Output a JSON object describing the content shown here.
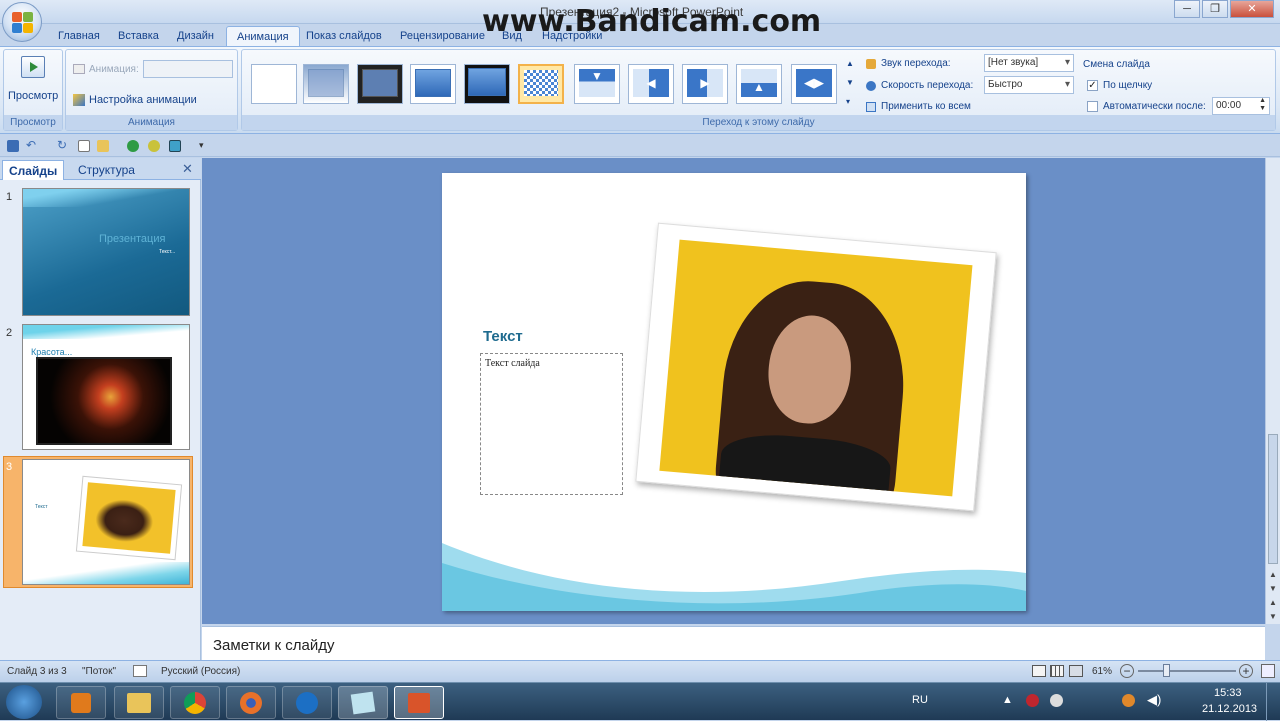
{
  "window": {
    "title": "Презентация2 - Microsoft PowerPoint",
    "watermark": "www.Bandicam.com",
    "minimize": "─",
    "maximize": "❐",
    "close": "✕"
  },
  "ribbon_tabs": [
    "Главная",
    "Вставка",
    "Дизайн",
    "Анимация",
    "Показ слайдов",
    "Рецензирование",
    "Вид",
    "Надстройки"
  ],
  "active_tab": "Анимация",
  "ribbon": {
    "preview": {
      "button": "Просмотр",
      "group": "Просмотр"
    },
    "animation": {
      "animation_label": "Анимация:",
      "animation_value": "",
      "custom": "Настройка анимации",
      "group": "Анимация"
    },
    "transitions": {
      "group": "Переход к этому слайду",
      "selected_index": 5,
      "count": 11
    },
    "transition_options": {
      "sound_label": "Звук перехода:",
      "sound_value": "[Нет звука]",
      "speed_label": "Скорость перехода:",
      "speed_value": "Быстро",
      "apply_all": "Применить ко всем"
    },
    "slide_advance": {
      "title": "Смена слайда",
      "on_click": "По щелчку",
      "on_click_checked": true,
      "auto_after": "Автоматически после:",
      "auto_checked": false,
      "auto_time": "00:00"
    }
  },
  "panel": {
    "tabs": [
      "Слайды",
      "Структура"
    ],
    "close": "✕",
    "slides": [
      {
        "num": "1",
        "title": "Презентация",
        "sub": "Текст..."
      },
      {
        "num": "2",
        "title": "Красота..."
      },
      {
        "num": "3",
        "title": "Текст"
      }
    ],
    "selected_slide": 3
  },
  "slide": {
    "heading": "Текст",
    "body": "Текст слайда"
  },
  "notes_placeholder": "Заметки к слайду",
  "status": {
    "slide_info": "Слайд 3 из 3",
    "theme": "\"Поток\"",
    "language": "Русский (Россия)",
    "zoom": "61%",
    "zoom_fraction": 0.61
  },
  "taskbar": {
    "lang": "RU",
    "time": "15:33",
    "date": "21.12.2013"
  },
  "colors": {
    "accent": "#15428b",
    "slide_heading": "#1f6b8f",
    "selected_slide": "#f3a04a"
  }
}
